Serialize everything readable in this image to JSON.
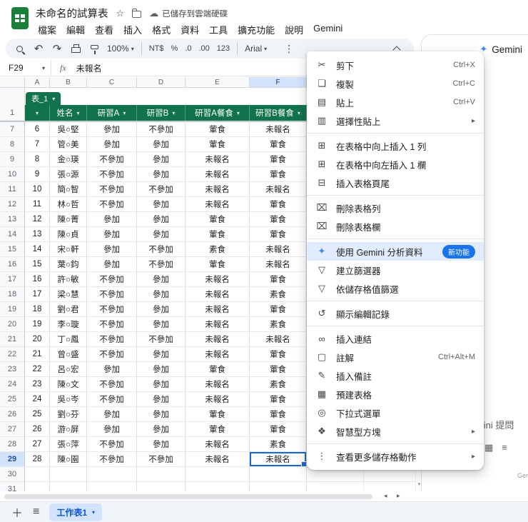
{
  "colors": {
    "table_green": "#11734b",
    "accent_blue": "#0b57d0",
    "selection_blue": "#1967d2",
    "highlight_blue": "#d3e3fd",
    "badge_blue": "#1a73e8"
  },
  "titlebar": {
    "doc_title": "未命名的試算表",
    "saved_status": "已儲存到雲端硬碟",
    "menus": [
      "檔案",
      "編輯",
      "查看",
      "插入",
      "格式",
      "資料",
      "工具",
      "擴充功能",
      "說明",
      "Gemini"
    ]
  },
  "toolbar": {
    "zoom": "100%",
    "currency": "NT$",
    "percent": "%",
    "dec_decrease": ".0",
    "dec_increase": ".00",
    "number_format": "123",
    "font_name": "Arial"
  },
  "formula_bar": {
    "cell_ref": "F29",
    "fx": "fx",
    "value": "未報名"
  },
  "grid": {
    "column_letters": [
      "A",
      "B",
      "C",
      "D",
      "E",
      "F"
    ],
    "selected_column": "F",
    "selected_row": 29,
    "table_chip": "表_1",
    "header_row_num": "1",
    "headers": [
      "",
      "姓名",
      "研習A",
      "研習B",
      "研習A餐食",
      "研習B餐食"
    ],
    "rows": [
      {
        "n": "7",
        "cells": [
          "6",
          "吳○堅",
          "參加",
          "不參加",
          "葷食",
          "未報名"
        ]
      },
      {
        "n": "8",
        "cells": [
          "7",
          "管○美",
          "參加",
          "參加",
          "葷食",
          "葷食"
        ]
      },
      {
        "n": "9",
        "cells": [
          "8",
          "金○瑛",
          "不參加",
          "參加",
          "未報名",
          "葷食"
        ]
      },
      {
        "n": "10",
        "cells": [
          "9",
          "張○源",
          "不參加",
          "參加",
          "未報名",
          "葷食"
        ]
      },
      {
        "n": "11",
        "cells": [
          "10",
          "簡○智",
          "不參加",
          "不參加",
          "未報名",
          "未報名"
        ]
      },
      {
        "n": "12",
        "cells": [
          "11",
          "林○哲",
          "不參加",
          "參加",
          "未報名",
          "葷食"
        ]
      },
      {
        "n": "13",
        "cells": [
          "12",
          "陳○菁",
          "參加",
          "參加",
          "葷食",
          "葷食"
        ]
      },
      {
        "n": "14",
        "cells": [
          "13",
          "陳○貞",
          "參加",
          "參加",
          "葷食",
          "葷食"
        ]
      },
      {
        "n": "15",
        "cells": [
          "14",
          "宋○軒",
          "參加",
          "不參加",
          "素食",
          "未報名"
        ]
      },
      {
        "n": "16",
        "cells": [
          "15",
          "葉○鈞",
          "參加",
          "不參加",
          "葷食",
          "未報名"
        ]
      },
      {
        "n": "17",
        "cells": [
          "16",
          "許○敏",
          "不參加",
          "參加",
          "未報名",
          "葷食"
        ]
      },
      {
        "n": "18",
        "cells": [
          "17",
          "梁○慧",
          "不參加",
          "參加",
          "未報名",
          "素食"
        ]
      },
      {
        "n": "19",
        "cells": [
          "18",
          "劉○君",
          "不參加",
          "參加",
          "未報名",
          "葷食"
        ]
      },
      {
        "n": "20",
        "cells": [
          "19",
          "李○璇",
          "不參加",
          "參加",
          "未報名",
          "素食"
        ]
      },
      {
        "n": "21",
        "cells": [
          "20",
          "丁○鳳",
          "不參加",
          "不參加",
          "未報名",
          "未報名"
        ]
      },
      {
        "n": "22",
        "cells": [
          "21",
          "曾○盛",
          "不參加",
          "參加",
          "未報名",
          "葷食"
        ]
      },
      {
        "n": "23",
        "cells": [
          "22",
          "呂○宏",
          "參加",
          "參加",
          "葷食",
          "葷食"
        ]
      },
      {
        "n": "24",
        "cells": [
          "23",
          "陳○文",
          "不參加",
          "參加",
          "未報名",
          "素食"
        ]
      },
      {
        "n": "25",
        "cells": [
          "24",
          "吳○岑",
          "不參加",
          "參加",
          "未報名",
          "葷食"
        ]
      },
      {
        "n": "26",
        "cells": [
          "25",
          "劉○芬",
          "參加",
          "參加",
          "葷食",
          "葷食"
        ]
      },
      {
        "n": "27",
        "cells": [
          "26",
          "游○屏",
          "參加",
          "參加",
          "葷食",
          "葷食"
        ]
      },
      {
        "n": "28",
        "cells": [
          "27",
          "張○萍",
          "不參加",
          "參加",
          "未報名",
          "素食"
        ]
      },
      {
        "n": "29",
        "cells": [
          "28",
          "陳○園",
          "不參加",
          "不參加",
          "未報名",
          "未報名"
        ]
      },
      {
        "n": "30",
        "cells": [
          "",
          "",
          "",
          "",
          "",
          ""
        ]
      },
      {
        "n": "31",
        "cells": [
          "",
          "",
          "",
          "",
          "",
          ""
        ]
      }
    ]
  },
  "context_menu": {
    "items": [
      {
        "icon": "cut-icon",
        "glyph": "✂",
        "label": "剪下",
        "shortcut": "Ctrl+X"
      },
      {
        "icon": "copy-icon",
        "glyph": "❏",
        "label": "複製",
        "shortcut": "Ctrl+C"
      },
      {
        "icon": "paste-icon",
        "glyph": "▤",
        "label": "貼上",
        "shortcut": "Ctrl+V"
      },
      {
        "icon": "paste-special-icon",
        "glyph": "▥",
        "label": "選擇性貼上",
        "submenu": true
      },
      {
        "divider": true
      },
      {
        "icon": "insert-row-above-icon",
        "glyph": "⊞",
        "label": "在表格中向上插入 1 列"
      },
      {
        "icon": "insert-col-left-icon",
        "glyph": "⊞",
        "label": "在表格中向左插入 1 欄"
      },
      {
        "icon": "insert-table-footer-icon",
        "glyph": "⊟",
        "label": "插入表格頁尾"
      },
      {
        "divider": true
      },
      {
        "icon": "delete-table-row-icon",
        "glyph": "⌧",
        "label": "刪除表格列"
      },
      {
        "icon": "delete-table-col-icon",
        "glyph": "⌧",
        "label": "刪除表格欄"
      },
      {
        "divider": true
      },
      {
        "icon": "gemini-sparkle-icon",
        "glyph": "✦",
        "label": "使用 Gemini 分析資料",
        "badge": "新功能",
        "highlight": true
      },
      {
        "icon": "create-filter-icon",
        "glyph": "▽",
        "label": "建立篩選器"
      },
      {
        "icon": "filter-by-value-icon",
        "glyph": "▽",
        "label": "依儲存格值篩選"
      },
      {
        "divider": true
      },
      {
        "icon": "edit-history-icon",
        "glyph": "↺",
        "label": "顯示編輯記錄"
      },
      {
        "divider": true
      },
      {
        "icon": "insert-link-icon",
        "glyph": "∞",
        "label": "插入連結"
      },
      {
        "icon": "comment-icon",
        "glyph": "▢",
        "label": "註解",
        "shortcut": "Ctrl+Alt+M"
      },
      {
        "icon": "insert-note-icon",
        "glyph": "✎",
        "label": "插入備註"
      },
      {
        "icon": "prebuilt-tables-icon",
        "glyph": "▦",
        "label": "預建表格"
      },
      {
        "icon": "dropdown-chip-icon",
        "glyph": "◎",
        "label": "下拉式選單"
      },
      {
        "icon": "smart-chips-icon",
        "glyph": "❖",
        "label": "智慧型方塊",
        "submenu": true
      },
      {
        "divider": true
      },
      {
        "icon": "more-cell-actions-icon",
        "glyph": "⋮",
        "label": "查看更多儲存格動作",
        "submenu": true
      }
    ]
  },
  "gemini_panel": {
    "title": "Gemini",
    "prompt_placeholder": "向 Gemini 提問",
    "disclaimer": "Gemini"
  },
  "sheet_bar": {
    "tab_name": "工作表1"
  }
}
